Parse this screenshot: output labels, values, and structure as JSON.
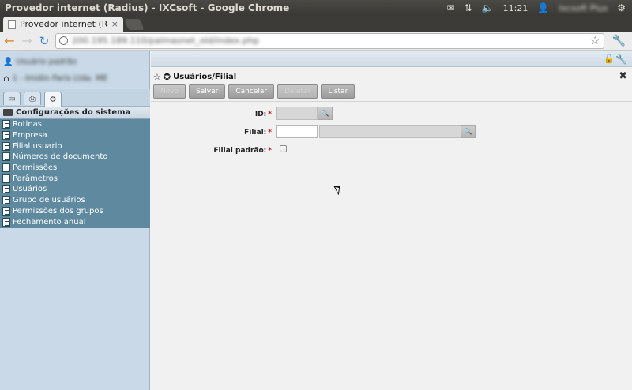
{
  "os": {
    "window_title": "Provedor internet (Radius) - IXCsoft - Google Chrome",
    "clock": "11:21",
    "user": "Ixcsoft Plus"
  },
  "browser": {
    "tab_label": "Provedor internet (Radius",
    "tab_close": "×",
    "url": "200.195.189.110/palmasnet_old/index.php"
  },
  "sidebar": {
    "user": "Usuário padrão",
    "company": "1 - Imidio Paris Ltda. ME",
    "section_title": "Configurações do sistema",
    "items": [
      {
        "label": "Rotinas"
      },
      {
        "label": "Empresa"
      },
      {
        "label": "Filial usuario"
      },
      {
        "label": "Números de documento"
      },
      {
        "label": "Permissões"
      },
      {
        "label": "Parâmetros"
      },
      {
        "label": "Usuários"
      },
      {
        "label": "Grupo de usuários"
      },
      {
        "label": "Permissões dos grupos"
      },
      {
        "label": "Fechamento anual"
      }
    ]
  },
  "form": {
    "title": "Usuários/Filial",
    "buttons": {
      "novo": "Novo",
      "salvar": "Salvar",
      "cancelar": "Cancelar",
      "deletar": "Deletar",
      "listar": "Listar"
    },
    "fields": {
      "id_label": "ID:",
      "filial_label": "Filial:",
      "filial_padrao_label": "Filial padrão:",
      "required_mark": "*"
    }
  },
  "icons": {
    "back": "arrow-left-icon",
    "forward": "arrow-right-icon",
    "reload": "reload-icon",
    "star": "star-icon",
    "wrench": "wrench-icon",
    "home": "home-icon",
    "user": "user-icon",
    "lock": "unlock-icon",
    "search": "search-icon"
  },
  "colors": {
    "menu_bg": "#5e899f",
    "sidebar_bg": "#c9d9e7",
    "required": "#d01818",
    "button_bg": "#a9a9a9"
  }
}
